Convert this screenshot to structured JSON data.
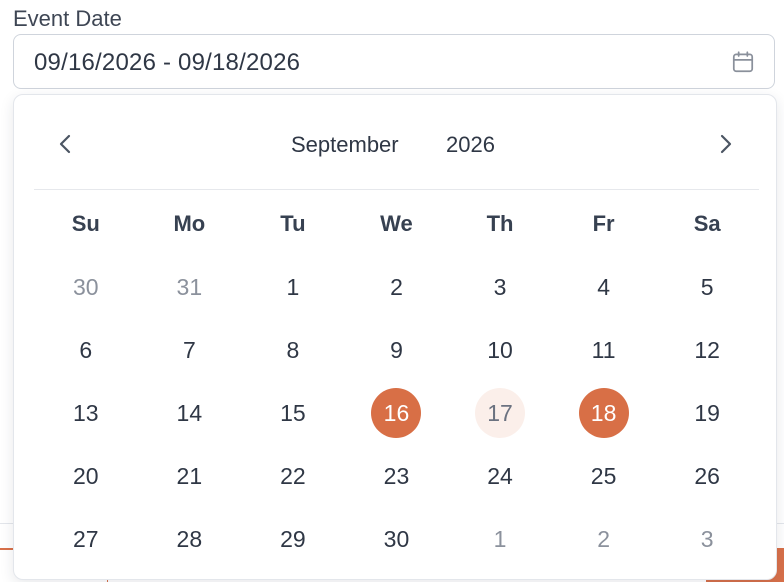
{
  "field": {
    "label": "Event Date",
    "value": "09/16/2026 - 09/18/2026",
    "icon": "calendar-icon"
  },
  "calendar": {
    "month": "September",
    "year": "2026",
    "prev_icon": "chevron-left-icon",
    "next_icon": "chevron-right-icon",
    "accent_color": "#d86f46",
    "range_tint": "#fbefea",
    "weekdays": [
      "Su",
      "Mo",
      "Tu",
      "We",
      "Th",
      "Fr",
      "Sa"
    ],
    "weeks": [
      [
        {
          "label": "30",
          "state": "outside"
        },
        {
          "label": "31",
          "state": "outside"
        },
        {
          "label": "1",
          "state": "normal"
        },
        {
          "label": "2",
          "state": "normal"
        },
        {
          "label": "3",
          "state": "normal"
        },
        {
          "label": "4",
          "state": "normal"
        },
        {
          "label": "5",
          "state": "normal"
        }
      ],
      [
        {
          "label": "6",
          "state": "normal"
        },
        {
          "label": "7",
          "state": "normal"
        },
        {
          "label": "8",
          "state": "normal"
        },
        {
          "label": "9",
          "state": "normal"
        },
        {
          "label": "10",
          "state": "normal"
        },
        {
          "label": "11",
          "state": "normal"
        },
        {
          "label": "12",
          "state": "normal"
        }
      ],
      [
        {
          "label": "13",
          "state": "normal"
        },
        {
          "label": "14",
          "state": "normal"
        },
        {
          "label": "15",
          "state": "normal"
        },
        {
          "label": "16",
          "state": "range-start"
        },
        {
          "label": "17",
          "state": "in-range"
        },
        {
          "label": "18",
          "state": "range-end"
        },
        {
          "label": "19",
          "state": "normal"
        }
      ],
      [
        {
          "label": "20",
          "state": "normal"
        },
        {
          "label": "21",
          "state": "normal"
        },
        {
          "label": "22",
          "state": "normal"
        },
        {
          "label": "23",
          "state": "normal"
        },
        {
          "label": "24",
          "state": "normal"
        },
        {
          "label": "25",
          "state": "normal"
        },
        {
          "label": "26",
          "state": "normal"
        }
      ],
      [
        {
          "label": "27",
          "state": "normal"
        },
        {
          "label": "28",
          "state": "normal"
        },
        {
          "label": "29",
          "state": "normal"
        },
        {
          "label": "30",
          "state": "normal"
        },
        {
          "label": "1",
          "state": "outside"
        },
        {
          "label": "2",
          "state": "outside"
        },
        {
          "label": "3",
          "state": "outside"
        }
      ]
    ]
  }
}
